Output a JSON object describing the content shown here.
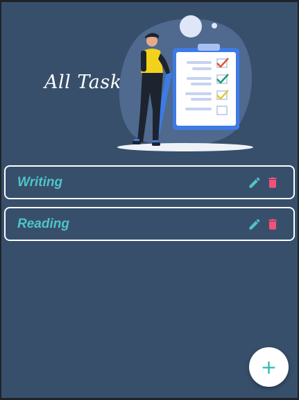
{
  "header": {
    "title": "All Tasks",
    "illustration": "person-with-checklist-clipboard"
  },
  "tasks": [
    {
      "label": "Writing",
      "edit_icon": "pencil-icon",
      "delete_icon": "trash-icon"
    },
    {
      "label": "Reading",
      "edit_icon": "pencil-icon",
      "delete_icon": "trash-icon"
    }
  ],
  "fab": {
    "icon": "plus-icon",
    "glyph": "+"
  },
  "colors": {
    "background": "#374f6b",
    "task_text": "#4fc3c9",
    "edit_icon": "#4fc3c9",
    "delete_icon": "#f2527a",
    "fab_background": "#ffffff",
    "fab_icon": "#2bbbad"
  }
}
